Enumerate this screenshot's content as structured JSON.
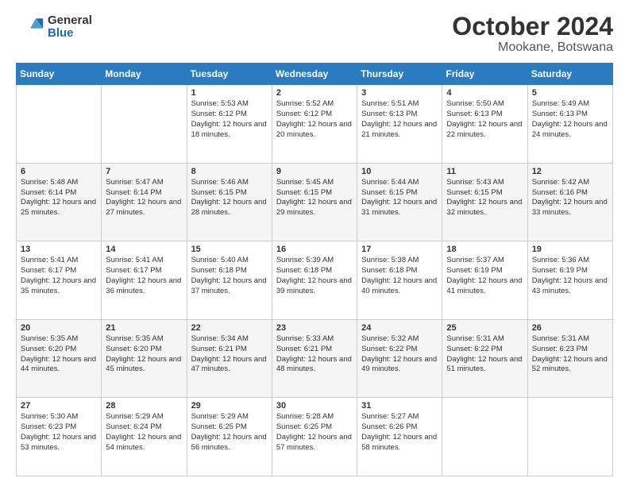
{
  "header": {
    "logo_general": "General",
    "logo_blue": "Blue",
    "title": "October 2024",
    "subtitle": "Mookane, Botswana"
  },
  "days_of_week": [
    "Sunday",
    "Monday",
    "Tuesday",
    "Wednesday",
    "Thursday",
    "Friday",
    "Saturday"
  ],
  "weeks": [
    [
      {
        "num": "",
        "info": ""
      },
      {
        "num": "",
        "info": ""
      },
      {
        "num": "1",
        "info": "Sunrise: 5:53 AM\nSunset: 6:12 PM\nDaylight: 12 hours and 18 minutes."
      },
      {
        "num": "2",
        "info": "Sunrise: 5:52 AM\nSunset: 6:12 PM\nDaylight: 12 hours and 20 minutes."
      },
      {
        "num": "3",
        "info": "Sunrise: 5:51 AM\nSunset: 6:13 PM\nDaylight: 12 hours and 21 minutes."
      },
      {
        "num": "4",
        "info": "Sunrise: 5:50 AM\nSunset: 6:13 PM\nDaylight: 12 hours and 22 minutes."
      },
      {
        "num": "5",
        "info": "Sunrise: 5:49 AM\nSunset: 6:13 PM\nDaylight: 12 hours and 24 minutes."
      }
    ],
    [
      {
        "num": "6",
        "info": "Sunrise: 5:48 AM\nSunset: 6:14 PM\nDaylight: 12 hours and 25 minutes."
      },
      {
        "num": "7",
        "info": "Sunrise: 5:47 AM\nSunset: 6:14 PM\nDaylight: 12 hours and 27 minutes."
      },
      {
        "num": "8",
        "info": "Sunrise: 5:46 AM\nSunset: 6:15 PM\nDaylight: 12 hours and 28 minutes."
      },
      {
        "num": "9",
        "info": "Sunrise: 5:45 AM\nSunset: 6:15 PM\nDaylight: 12 hours and 29 minutes."
      },
      {
        "num": "10",
        "info": "Sunrise: 5:44 AM\nSunset: 6:15 PM\nDaylight: 12 hours and 31 minutes."
      },
      {
        "num": "11",
        "info": "Sunrise: 5:43 AM\nSunset: 6:15 PM\nDaylight: 12 hours and 32 minutes."
      },
      {
        "num": "12",
        "info": "Sunrise: 5:42 AM\nSunset: 6:16 PM\nDaylight: 12 hours and 33 minutes."
      }
    ],
    [
      {
        "num": "13",
        "info": "Sunrise: 5:41 AM\nSunset: 6:17 PM\nDaylight: 12 hours and 35 minutes."
      },
      {
        "num": "14",
        "info": "Sunrise: 5:41 AM\nSunset: 6:17 PM\nDaylight: 12 hours and 36 minutes."
      },
      {
        "num": "15",
        "info": "Sunrise: 5:40 AM\nSunset: 6:18 PM\nDaylight: 12 hours and 37 minutes."
      },
      {
        "num": "16",
        "info": "Sunrise: 5:39 AM\nSunset: 6:18 PM\nDaylight: 12 hours and 39 minutes."
      },
      {
        "num": "17",
        "info": "Sunrise: 5:38 AM\nSunset: 6:18 PM\nDaylight: 12 hours and 40 minutes."
      },
      {
        "num": "18",
        "info": "Sunrise: 5:37 AM\nSunset: 6:19 PM\nDaylight: 12 hours and 41 minutes."
      },
      {
        "num": "19",
        "info": "Sunrise: 5:36 AM\nSunset: 6:19 PM\nDaylight: 12 hours and 43 minutes."
      }
    ],
    [
      {
        "num": "20",
        "info": "Sunrise: 5:35 AM\nSunset: 6:20 PM\nDaylight: 12 hours and 44 minutes."
      },
      {
        "num": "21",
        "info": "Sunrise: 5:35 AM\nSunset: 6:20 PM\nDaylight: 12 hours and 45 minutes."
      },
      {
        "num": "22",
        "info": "Sunrise: 5:34 AM\nSunset: 6:21 PM\nDaylight: 12 hours and 47 minutes."
      },
      {
        "num": "23",
        "info": "Sunrise: 5:33 AM\nSunset: 6:21 PM\nDaylight: 12 hours and 48 minutes."
      },
      {
        "num": "24",
        "info": "Sunrise: 5:32 AM\nSunset: 6:22 PM\nDaylight: 12 hours and 49 minutes."
      },
      {
        "num": "25",
        "info": "Sunrise: 5:31 AM\nSunset: 6:22 PM\nDaylight: 12 hours and 51 minutes."
      },
      {
        "num": "26",
        "info": "Sunrise: 5:31 AM\nSunset: 6:23 PM\nDaylight: 12 hours and 52 minutes."
      }
    ],
    [
      {
        "num": "27",
        "info": "Sunrise: 5:30 AM\nSunset: 6:23 PM\nDaylight: 12 hours and 53 minutes."
      },
      {
        "num": "28",
        "info": "Sunrise: 5:29 AM\nSunset: 6:24 PM\nDaylight: 12 hours and 54 minutes."
      },
      {
        "num": "29",
        "info": "Sunrise: 5:29 AM\nSunset: 6:25 PM\nDaylight: 12 hours and 56 minutes."
      },
      {
        "num": "30",
        "info": "Sunrise: 5:28 AM\nSunset: 6:25 PM\nDaylight: 12 hours and 57 minutes."
      },
      {
        "num": "31",
        "info": "Sunrise: 5:27 AM\nSunset: 6:26 PM\nDaylight: 12 hours and 58 minutes."
      },
      {
        "num": "",
        "info": ""
      },
      {
        "num": "",
        "info": ""
      }
    ]
  ]
}
